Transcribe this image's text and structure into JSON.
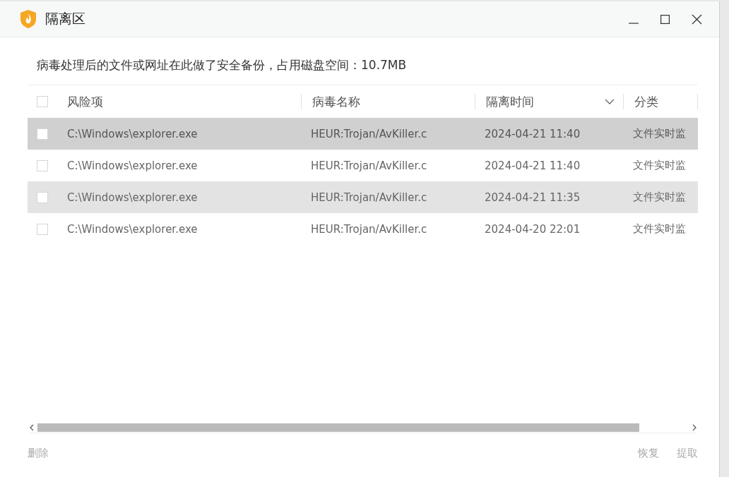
{
  "window": {
    "title": "隔离区"
  },
  "description": "病毒处理后的文件或网址在此做了安全备份，占用磁盘空间：10.7MB",
  "table": {
    "select_all": {
      "checked": false
    },
    "columns": [
      {
        "label": "风险项"
      },
      {
        "label": "病毒名称"
      },
      {
        "label": "隔离时间",
        "sortable": true
      },
      {
        "label": "分类"
      }
    ],
    "rows": [
      {
        "checked": false,
        "selected": true,
        "highlighted": false,
        "cells": [
          "C:\\Windows\\explorer.exe",
          "HEUR:Trojan/AvKiller.c",
          "2024-04-21 11:40",
          "文件实时监"
        ]
      },
      {
        "checked": false,
        "selected": false,
        "highlighted": false,
        "cells": [
          "C:\\Windows\\explorer.exe",
          "HEUR:Trojan/AvKiller.c",
          "2024-04-21 11:40",
          "文件实时监"
        ]
      },
      {
        "checked": false,
        "selected": false,
        "highlighted": true,
        "cells": [
          "C:\\Windows\\explorer.exe",
          "HEUR:Trojan/AvKiller.c",
          "2024-04-21 11:35",
          "文件实时监"
        ]
      },
      {
        "checked": false,
        "selected": false,
        "highlighted": false,
        "cells": [
          "C:\\Windows\\explorer.exe",
          "HEUR:Trojan/AvKiller.c",
          "2024-04-20 22:01",
          "文件实时监"
        ]
      }
    ]
  },
  "footer": {
    "left": [
      {
        "label": "删除",
        "disabled": true
      }
    ],
    "right": [
      {
        "label": "恢复",
        "disabled": true
      },
      {
        "label": "提取",
        "disabled": true
      }
    ]
  }
}
